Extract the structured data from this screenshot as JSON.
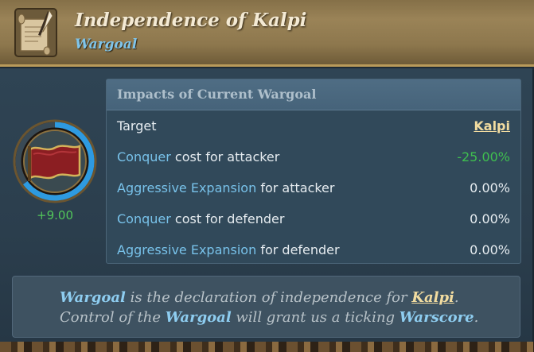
{
  "header": {
    "title": "Independence of Kalpi",
    "subtitle": "Wargoal",
    "icon": "scroll-quill-icon"
  },
  "wargoal_flag": {
    "score": "+9.00",
    "progress": 0.65,
    "flag_color": "#8b1e22"
  },
  "impacts": {
    "header": "Impacts of Current Wargoal",
    "rows": [
      {
        "label_kw": "",
        "label_rest": "Target",
        "value": "Kalpi",
        "value_style": "link"
      },
      {
        "label_kw": "Conquer",
        "label_rest": " cost for attacker",
        "value": "-25.00%",
        "value_style": "green"
      },
      {
        "label_kw": "Aggressive Expansion",
        "label_rest": " for attacker",
        "value": "0.00%",
        "value_style": "normal"
      },
      {
        "label_kw": "Conquer",
        "label_rest": " cost for defender",
        "value": "0.00%",
        "value_style": "normal"
      },
      {
        "label_kw": "Aggressive Expansion",
        "label_rest": " for defender",
        "value": "0.00%",
        "value_style": "normal"
      }
    ]
  },
  "description": {
    "line1": {
      "kw1": "Wargoal",
      "text1": " is the declaration of independence for ",
      "link": "Kalpi",
      "end": "."
    },
    "line2": {
      "text1": "Control of the ",
      "kw1": "Wargoal",
      "text2": " will grant us a ticking ",
      "kw2": "Warscore",
      "end": "."
    }
  },
  "colors": {
    "keyword": "#78c2ea",
    "positive": "#3fbf4f",
    "link": "#f2dca0",
    "header_gold": "#9a8357",
    "panel_blue": "#31495a"
  }
}
